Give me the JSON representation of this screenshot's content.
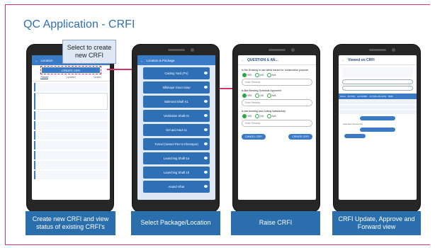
{
  "slide": {
    "title": "QC Application - CRFI"
  },
  "callout": {
    "text": "Select to create new CRFI"
  },
  "captions": [
    "Create new CRFI and view status of existing CRFI's",
    "Select Package/Location",
    "Raise CRFI",
    "CRFI Update, Approve and Forward view"
  ],
  "phone1": {
    "title": "Location",
    "create_button": "CREATE CRFI",
    "tabs": [
      "Raised",
      "Updated",
      "Closed"
    ]
  },
  "phone2": {
    "title": "Location & Package",
    "tiles": [
      "Casting Yard (PV)",
      "Silkinajur Goun ramp",
      "Balmoral Shaft K1",
      "Ventilation Shaft 01",
      "Gel and Haul 11",
      "Tunnel (Vessel Pier to Khetrapur)",
      "Launching Shaft 1a",
      "Launching Shaft 1b",
      "Anand Vihar"
    ]
  },
  "phone3": {
    "title": "QUESTION & AN...",
    "questions": [
      "Is the Drawing in use latest issued for construction purpose",
      "Is Bar Bending Schedule Approved",
      "Is bar bending and Cutting Satisfactory"
    ],
    "options": [
      "YES",
      "NO",
      "N/A"
    ],
    "remarks_placeholder": "Enter Remarks",
    "cancel_label": "CANCEL CRFI",
    "create_label": "CREATE CRFI"
  },
  "phone4": {
    "title": "Viewed on CRFI",
    "section_label": "Attached Documents",
    "table_headers": [
      "ROLE",
      "ACTION",
      "ACTIONBY",
      "ACTION ON DATE",
      "REM"
    ]
  },
  "colors": {
    "brand_blue": "#2f6fb6",
    "caption_blue": "#2a6ead",
    "accent_pink": "#d6336c"
  }
}
